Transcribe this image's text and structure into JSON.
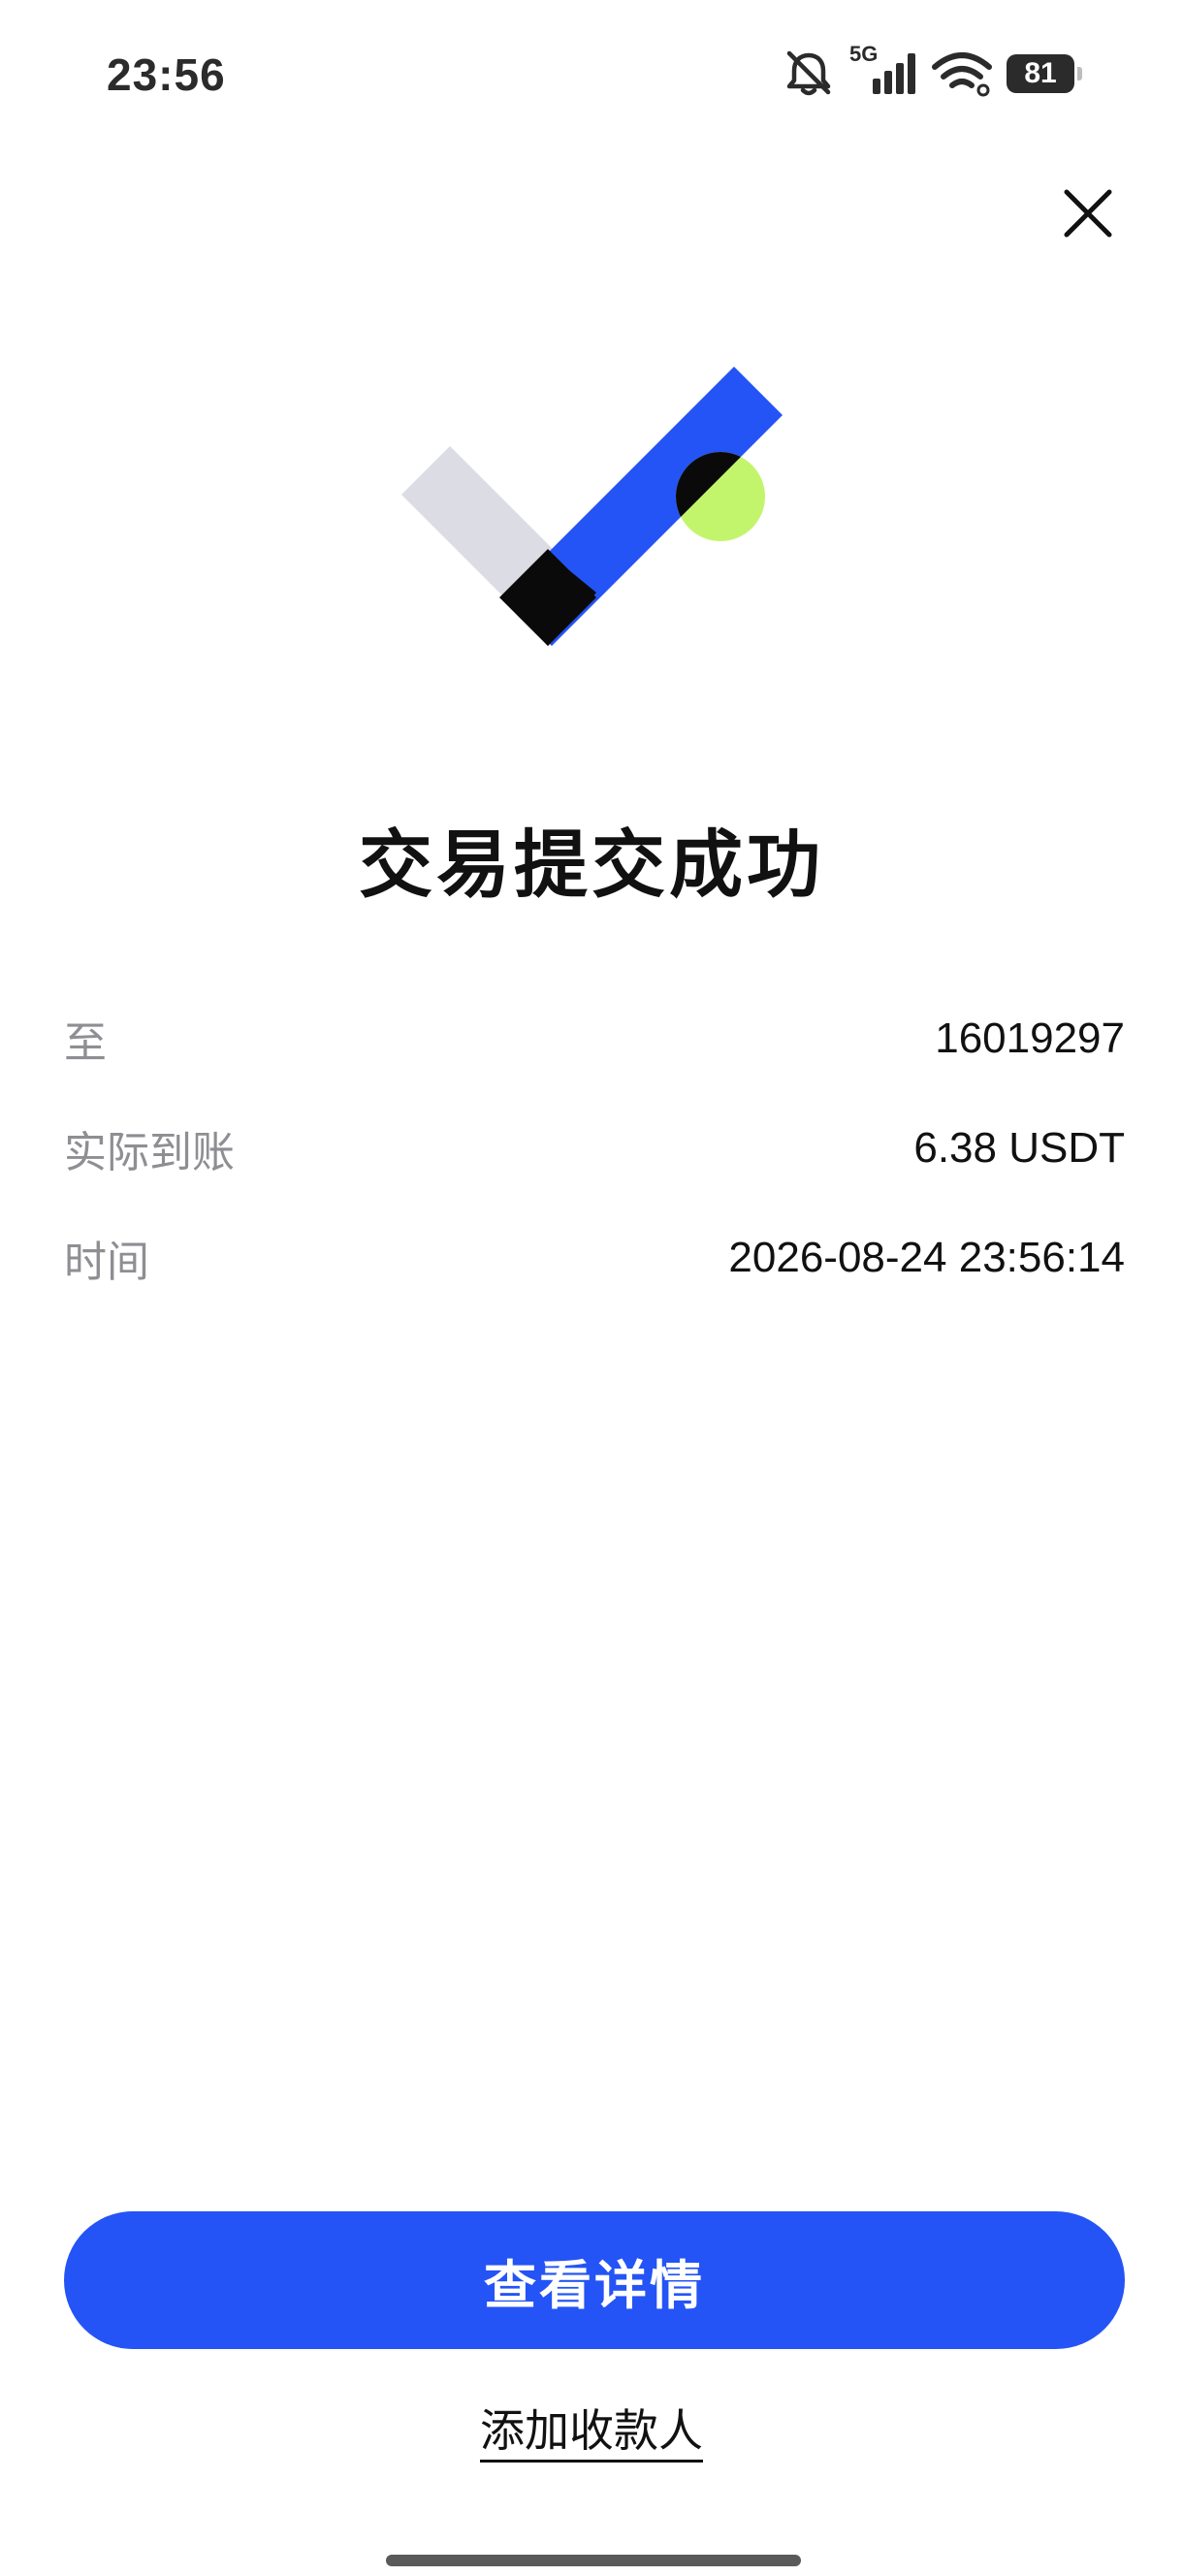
{
  "status_bar": {
    "time": "23:56",
    "network": "5G",
    "battery": "81",
    "icons": [
      "mute-bell-icon",
      "signal-icon",
      "wifi-icon",
      "battery-icon"
    ]
  },
  "header": {
    "close_icon": "close-icon"
  },
  "result": {
    "title": "交易提交成功",
    "illustration": "success-check-icon",
    "colors": {
      "blue": "#2454f5",
      "gray": "#dcdce4",
      "black": "#0a0a0a",
      "lime": "#c3f56c"
    }
  },
  "details": [
    {
      "label": "至",
      "value": "16019297"
    },
    {
      "label": "实际到账",
      "value": "6.38 USDT"
    },
    {
      "label": "时间",
      "value": "2026-08-24 23:56:14"
    }
  ],
  "actions": {
    "primary_label": "查看详情",
    "secondary_label": "添加收款人",
    "primary_color": "#2454f5"
  }
}
